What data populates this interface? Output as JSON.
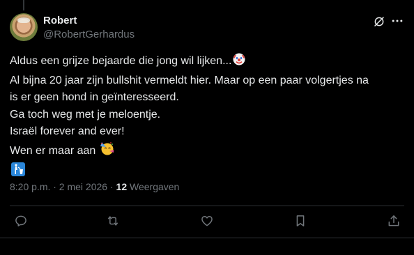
{
  "post": {
    "author_name": "Robert",
    "author_handle": "@RobertGerhardus",
    "lines": [
      "Aldus een grijze bejaarde die jong wil lijken...",
      "Al bijna 20 jaar zijn bullshit vermeldt hier. Maar op een paar volgertjes na",
      "is er geen hond in geïnteresseerd.",
      "Ga toch weg met je meloentje.",
      "Israël forever and ever!",
      "Wen er maar aan"
    ],
    "emojis": [
      "clown-face",
      "partying-face",
      "litter-in-bin-sign"
    ],
    "timestamp": "8:20 p.m. · 2 mei 2026 ·",
    "views_count": "12",
    "views_label": "Weergaven"
  },
  "colors": {
    "background": "#000000",
    "text": "#e7e9ea",
    "muted": "#71767b",
    "divider": "#2f3336"
  }
}
